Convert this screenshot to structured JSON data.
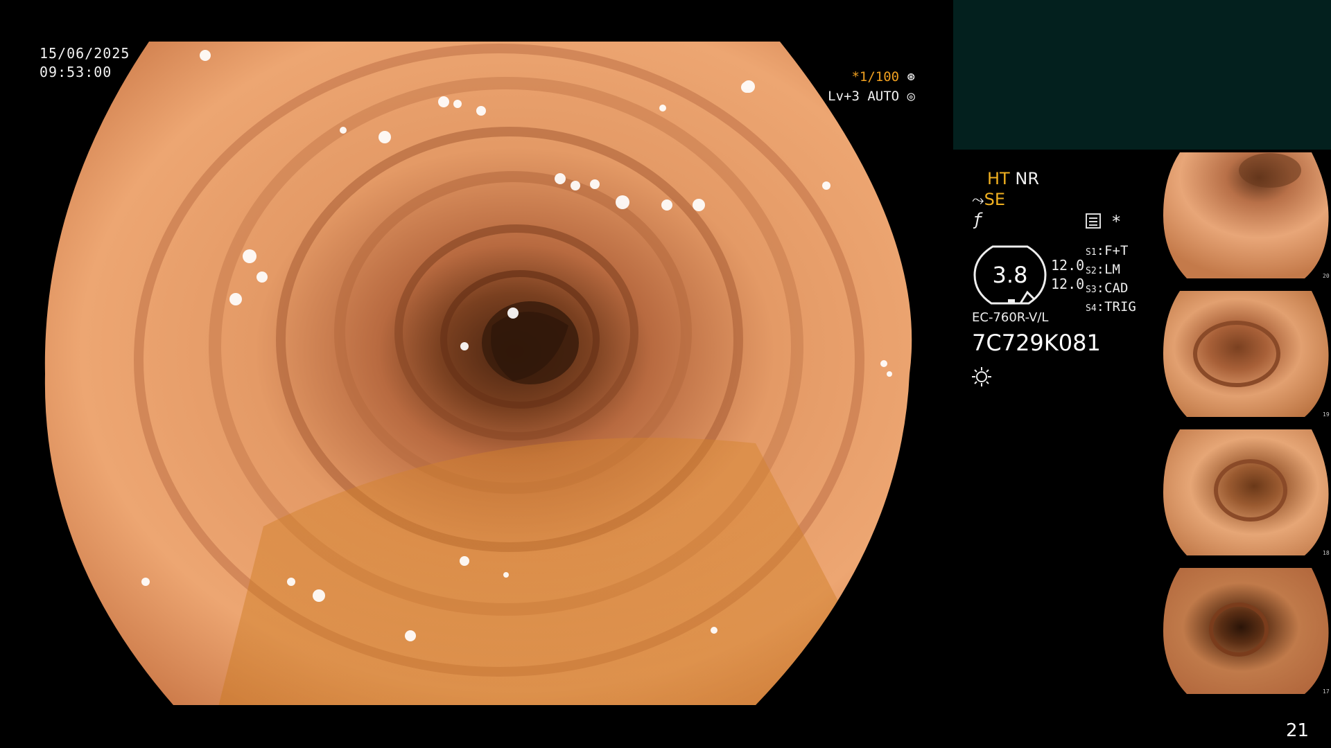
{
  "overlay": {
    "date": "15/06/2025",
    "time": "09:53:00",
    "shutter": "*1/100",
    "shutter_icon": "shutter-icon",
    "level": "Lv+3 AUTO",
    "level_icon": "iris-icon"
  },
  "panel": {
    "mode_ht": "HT",
    "mode_nr": "NR",
    "mode_se": "SE",
    "zoom_value": "3.8",
    "zoom_right_top": "12.0",
    "zoom_right_bottom": "12.0",
    "switches": [
      {
        "id": "S1",
        "label": "F+T"
      },
      {
        "id": "S2",
        "label": "LM"
      },
      {
        "id": "S3",
        "label": "CAD"
      },
      {
        "id": "S4",
        "label": "TRIG"
      }
    ],
    "scope_model": "EC-760R-V/L",
    "serial": "7C729K081",
    "asterisk": "*"
  },
  "thumbnails": [
    {
      "name": "thumbnail-1",
      "index": "20"
    },
    {
      "name": "thumbnail-2",
      "index": "19"
    },
    {
      "name": "thumbnail-3",
      "index": "18"
    },
    {
      "name": "thumbnail-4",
      "index": "17"
    }
  ],
  "page_number": "21",
  "colors": {
    "accent_yellow": "#f0b020",
    "panel_bg": "#03201e",
    "mucosa": "#d9844a"
  }
}
